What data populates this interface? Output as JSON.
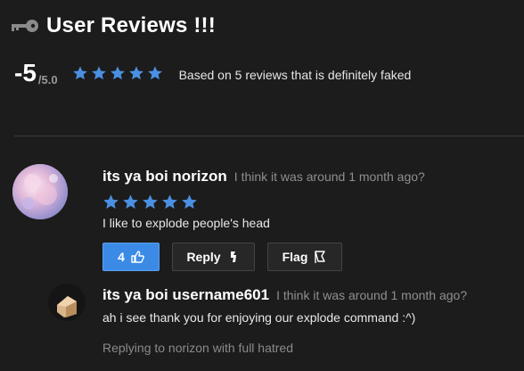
{
  "header": {
    "icon": "key-icon",
    "title": "User Reviews !!!"
  },
  "summary": {
    "score": "-5",
    "score_max": "/5.0",
    "stars": 5,
    "star_color": "#4a90e2",
    "text": "Based on 5 reviews that is definitely faked"
  },
  "review": {
    "author": "its ya boi norizon",
    "time": "I think it was around 1 month ago?",
    "stars": 5,
    "body": "I like to explode people's head",
    "actions": {
      "like_count": "4",
      "like_icon": "thumbs-up-icon",
      "reply_label": "Reply",
      "reply_icon": "reply-arrow-icon",
      "flag_label": "Flag",
      "flag_icon": "flag-icon"
    }
  },
  "reply": {
    "author": "its ya boi username601",
    "time": "I think it was around 1 month ago?",
    "body": "ah i see thank you for enjoying our explode command :^)",
    "footer": "Replying to norizon with full hatred"
  },
  "colors": {
    "background": "#1c1c1c",
    "accent": "#3b8ae6",
    "muted_text": "#8f8f8f"
  }
}
